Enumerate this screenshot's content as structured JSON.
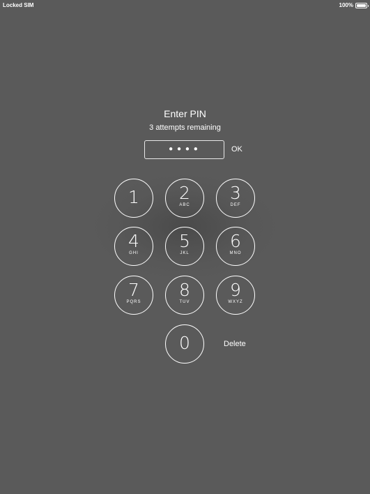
{
  "status_bar": {
    "carrier": "Locked SIM",
    "battery_percent": "100%",
    "battery_level": 1.0
  },
  "prompt": {
    "title": "Enter PIN",
    "subtitle": "3 attempts remaining"
  },
  "pin_field": {
    "value": "••••"
  },
  "ok_label": "OK",
  "keypad": {
    "keys": [
      {
        "digit": "1",
        "letters": ""
      },
      {
        "digit": "2",
        "letters": "ABC"
      },
      {
        "digit": "3",
        "letters": "DEF"
      },
      {
        "digit": "4",
        "letters": "GHI"
      },
      {
        "digit": "5",
        "letters": "JKL"
      },
      {
        "digit": "6",
        "letters": "MNO"
      },
      {
        "digit": "7",
        "letters": "PQRS"
      },
      {
        "digit": "8",
        "letters": "TUV"
      },
      {
        "digit": "9",
        "letters": "WXYZ"
      },
      {
        "digit": "0",
        "letters": ""
      }
    ],
    "delete_label": "Delete"
  }
}
